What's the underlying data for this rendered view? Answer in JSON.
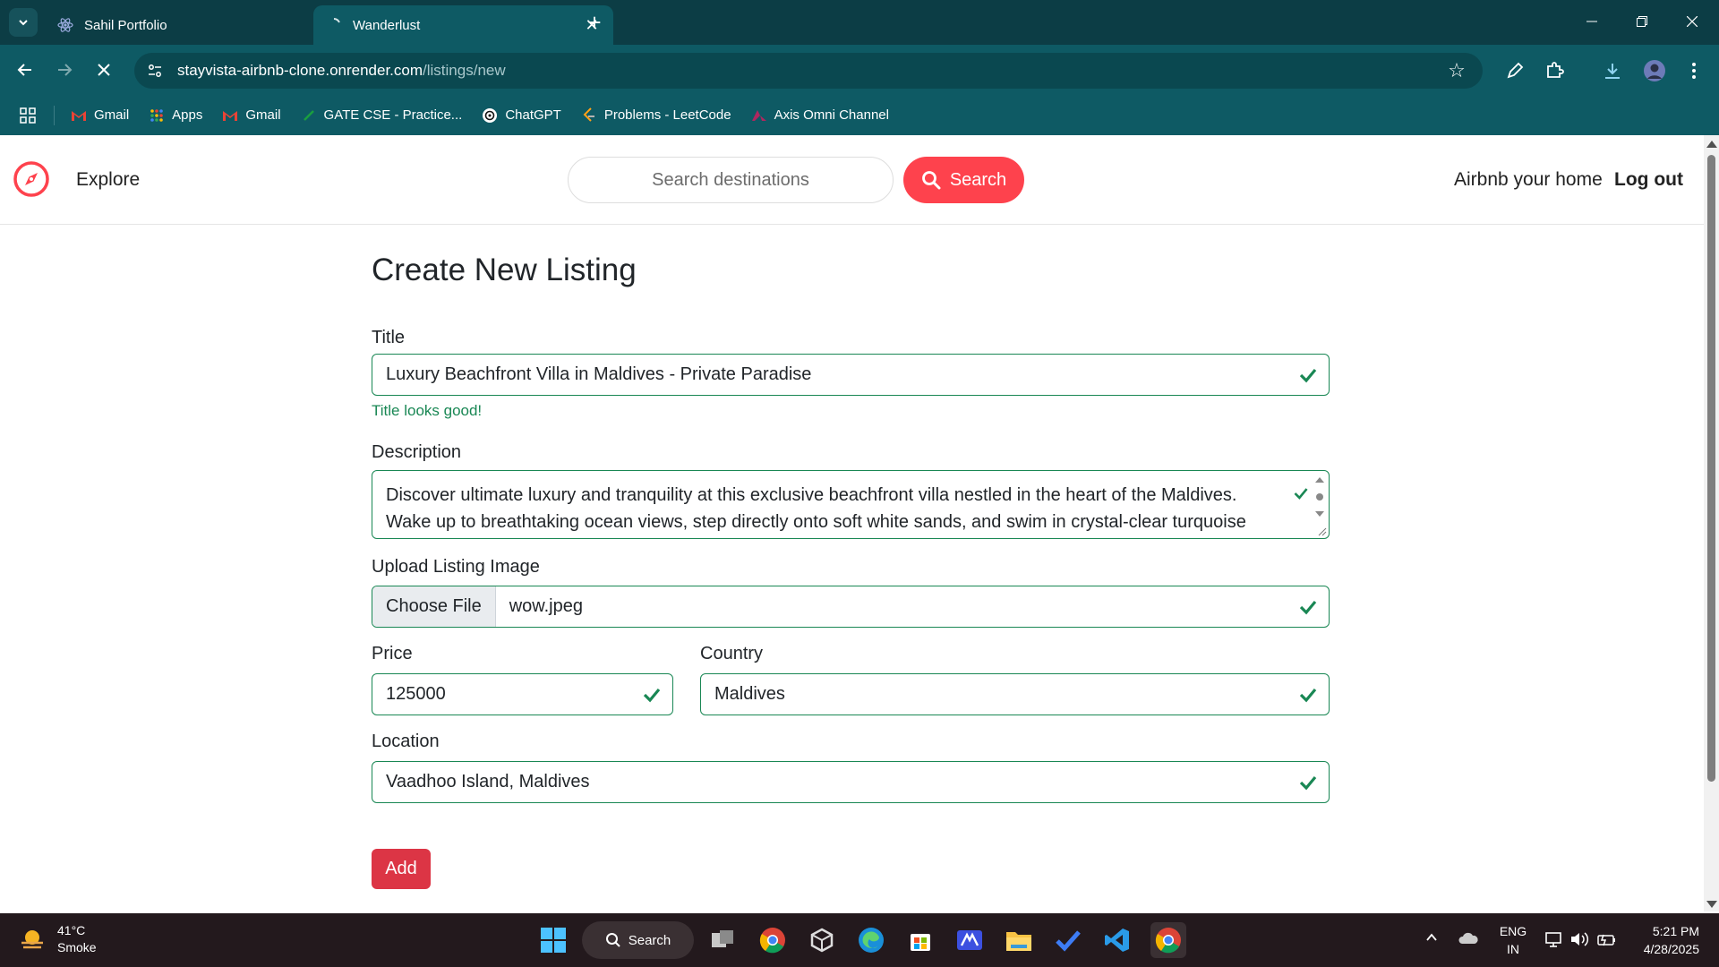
{
  "browser": {
    "tabs": [
      {
        "title": "Sahil Portfolio",
        "icon": "react-icon"
      },
      {
        "title": "Wanderlust",
        "icon": "loading-icon",
        "active": true
      }
    ],
    "url_host": "stayvista-airbnb-clone.onrender.com",
    "url_path": "/listings/new",
    "bookmarks": [
      {
        "label": "Gmail",
        "icon": "gmail-icon"
      },
      {
        "label": "Apps",
        "icon": "apps-grid-icon"
      },
      {
        "label": "Gmail",
        "icon": "gmail-icon"
      },
      {
        "label": "GATE CSE - Practice...",
        "icon": "gate-icon"
      },
      {
        "label": "ChatGPT",
        "icon": "chatgpt-icon"
      },
      {
        "label": "Problems - LeetCode",
        "icon": "leetcode-icon"
      },
      {
        "label": "Axis Omni Channel",
        "icon": "axis-icon"
      }
    ],
    "colors": {
      "frame": "#0c3d45",
      "toolbar": "#0e5a64"
    }
  },
  "navbar": {
    "explore": "Explore",
    "search_placeholder": "Search destinations",
    "search_button": "Search",
    "airbnb_home": "Airbnb your home",
    "logout": "Log out",
    "accent": "#fe424d"
  },
  "form": {
    "heading": "Create New Listing",
    "title_label": "Title",
    "title_value": "Luxury Beachfront Villa in Maldives - Private Paradise",
    "title_feedback": "Title looks good!",
    "description_label": "Description",
    "description_value": "Discover ultimate luxury and tranquility at this exclusive beachfront villa nestled in the heart of the Maldives. Wake up to breathtaking ocean views, step directly onto soft white sands, and swim in crystal-clear turquoise",
    "image_label": "Upload Listing Image",
    "choose_file": "Choose File",
    "file_name": "wow.jpeg",
    "price_label": "Price",
    "price_value": "125000",
    "country_label": "Country",
    "country_value": "Maldives",
    "location_label": "Location",
    "location_value": "Vaadhoo Island, Maldives",
    "add_button": "Add",
    "valid_color": "#198754"
  },
  "taskbar": {
    "temperature": "41°C",
    "weather": "Smoke",
    "search": "Search",
    "lang_top": "ENG",
    "lang_bottom": "IN",
    "time": "5:21 PM",
    "date": "4/28/2025"
  }
}
